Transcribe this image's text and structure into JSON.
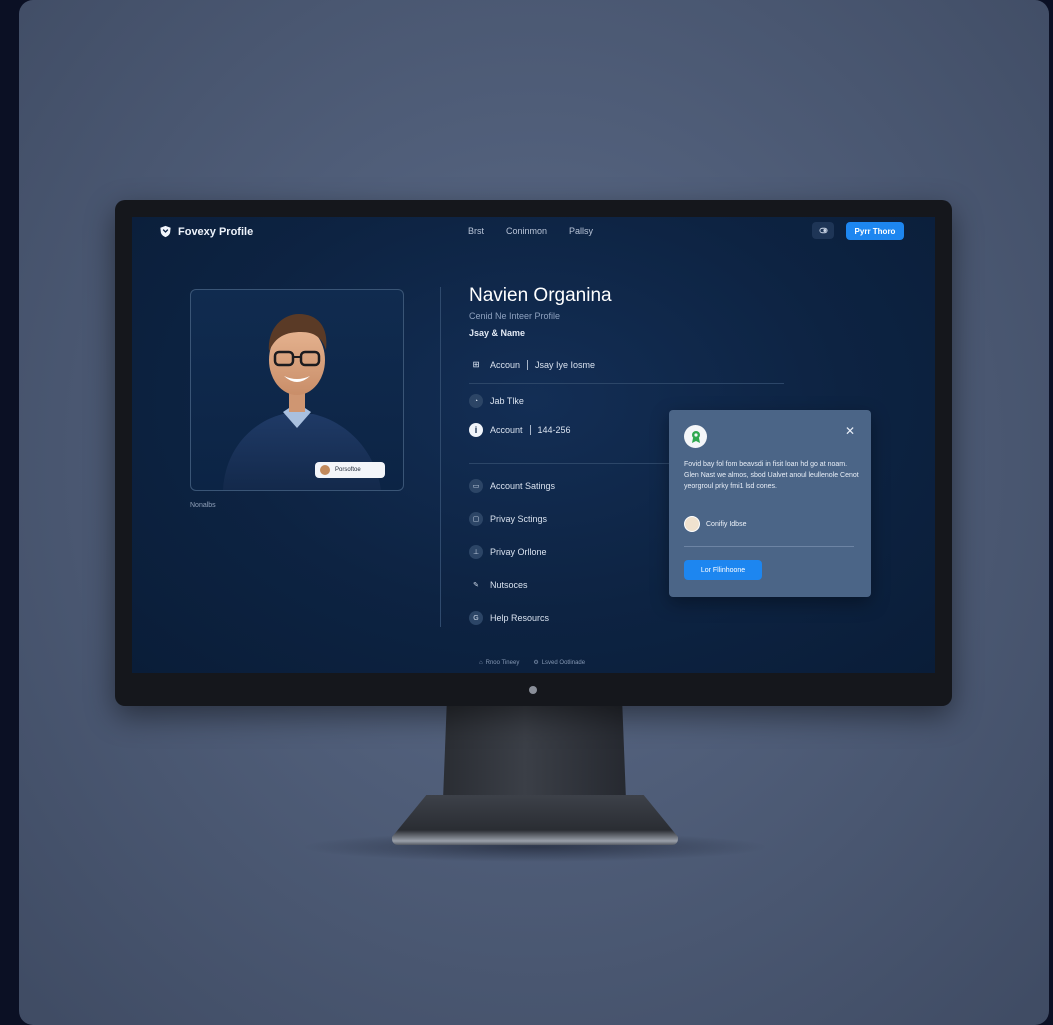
{
  "nav": {
    "brand": "Fovexy Profile",
    "links": [
      "Brst",
      "Coninmon",
      "Pallsy"
    ],
    "cta": "Pyrr Thoro"
  },
  "photo": {
    "badge": "Porsoftoe",
    "caption": "Nonalbs"
  },
  "profile": {
    "name": "Navien Organina",
    "subtitle": "Cenid Ne Inteer Profile",
    "label": "Jsay & Name",
    "account_row": {
      "label": "Accoun",
      "value": "Jsay Iye Iosme"
    },
    "job_title": "Jab Tlke",
    "account_id": {
      "label": "Account",
      "value": "144-256"
    },
    "menu": [
      {
        "icon": "chat-icon",
        "label": "Account Satings"
      },
      {
        "icon": "lock-icon",
        "label": "Privay Sctings"
      },
      {
        "icon": "user-icon",
        "label": "Privay Orllone"
      },
      {
        "icon": "pen-icon",
        "label": "Nutsoces"
      },
      {
        "icon": "help-icon",
        "label": "Help Resourcs"
      }
    ]
  },
  "popup": {
    "text": "Fovid bay fol fom beavsdi in fisit loan hd go at noam. Glen Nast we almos, sbod Ualvet anoul leullenole Cenot yeorgroul prky fmi1 lsd cones.",
    "user": "Conifiy Idbse",
    "button": "Lor Fllinhoone"
  },
  "footer": {
    "left": "Rnoo Tineey",
    "right": "Lsved Ootlinade"
  },
  "colors": {
    "screen_bg": "#0e2444",
    "accent": "#1d86f0",
    "popup_bg": "#4b6587"
  }
}
